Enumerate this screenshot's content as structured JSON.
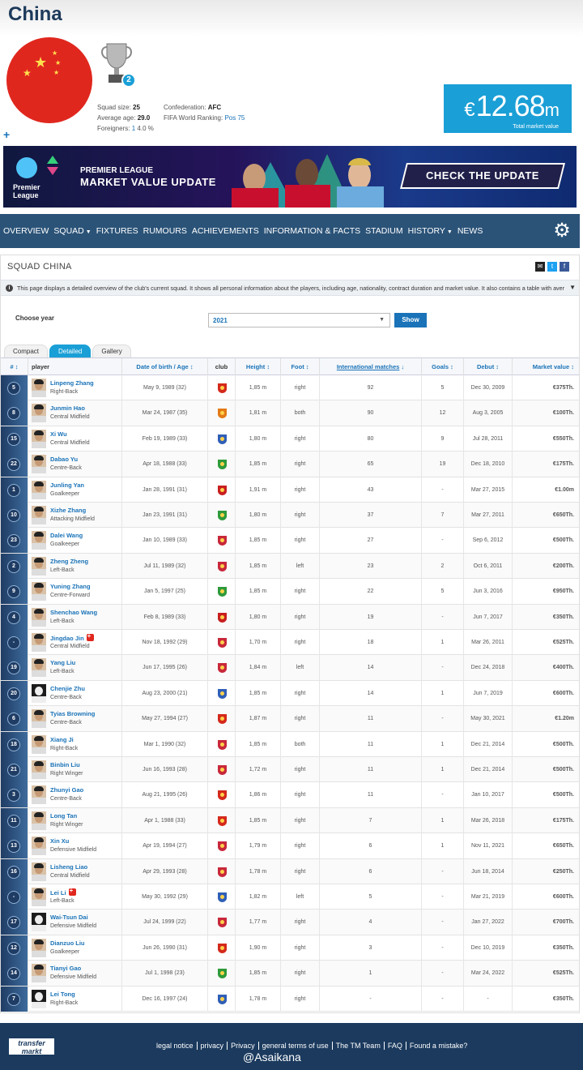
{
  "club": {
    "name": "China",
    "trophy_count": "2",
    "stats": {
      "squad_size_label": "Squad size:",
      "squad_size": "25",
      "average_age_label": "Average age:",
      "average_age": "29.0",
      "foreigners_label": "Foreigners:",
      "foreigners": "1",
      "foreigners_pct": "4.0 %",
      "confederation_label": "Confederation:",
      "confederation": "AFC",
      "ranking_label": "FIFA World Ranking:",
      "ranking": "Pos 75"
    },
    "market_value": {
      "currency": "€",
      "amount": "12.68",
      "unit": "m",
      "label": "Total market value"
    },
    "plus": "+"
  },
  "banner": {
    "logo_text": "Premier League",
    "line1": "PREMIER LEAGUE",
    "line2": "MARKET VALUE UPDATE",
    "cta": "CHECK THE UPDATE"
  },
  "nav": {
    "items": [
      {
        "label": "OVERVIEW",
        "dropdown": false
      },
      {
        "label": "SQUAD",
        "dropdown": true
      },
      {
        "label": "FIXTURES",
        "dropdown": false
      },
      {
        "label": "RUMOURS",
        "dropdown": false
      },
      {
        "label": "ACHIEVEMENTS",
        "dropdown": false
      },
      {
        "label": "INFORMATION & FACTS",
        "dropdown": false
      },
      {
        "label": "STADIUM",
        "dropdown": false
      },
      {
        "label": "HISTORY",
        "dropdown": true
      },
      {
        "label": "NEWS",
        "dropdown": false
      }
    ],
    "settings_icon": "gear-icon"
  },
  "squad": {
    "title": "SQUAD CHINA",
    "info_text": "This page displays a detailed overview of the club's current squad. It shows all personal information about the players, including age, nationality, contract duration and market value. It also contains a table with average age...",
    "choose_year_label": "Choose year",
    "year_value": "2021",
    "show_button": "Show",
    "tabs": [
      "Compact",
      "Detailed",
      "Gallery"
    ],
    "active_tab": "Detailed",
    "columns": {
      "num": "#",
      "player": "player",
      "dob": "Date of birth / Age",
      "club": "club",
      "height": "Height",
      "foot": "Foot",
      "intl": "International matches",
      "goals": "Goals",
      "debut": "Debut",
      "mv": "Market value"
    },
    "players": [
      {
        "num": "5",
        "name": "Linpeng Zhang",
        "pos": "Right-Back",
        "dob": "May 9, 1989 (32)",
        "height": "1,85 m",
        "foot": "right",
        "caps": "92",
        "goals": "5",
        "debut": "Dec 30, 2009",
        "mv": "€375Th.",
        "club_color": "#d4291b",
        "inj": false,
        "dark": false
      },
      {
        "num": "8",
        "name": "Junmin Hao",
        "pos": "Central Midfield",
        "dob": "Mar 24, 1987 (35)",
        "height": "1,81 m",
        "foot": "both",
        "caps": "90",
        "goals": "12",
        "debut": "Aug 3, 2005",
        "mv": "€100Th.",
        "club_color": "#e37a16",
        "inj": false,
        "dark": false
      },
      {
        "num": "15",
        "name": "Xi Wu",
        "pos": "Central Midfield",
        "dob": "Feb 19, 1989 (33)",
        "height": "1,80 m",
        "foot": "right",
        "caps": "80",
        "goals": "9",
        "debut": "Jul 28, 2011",
        "mv": "€550Th.",
        "club_color": "#2f5fb7",
        "inj": false,
        "dark": false
      },
      {
        "num": "22",
        "name": "Dabao Yu",
        "pos": "Centre-Back",
        "dob": "Apr 18, 1988 (33)",
        "height": "1,85 m",
        "foot": "right",
        "caps": "65",
        "goals": "19",
        "debut": "Dec 18, 2010",
        "mv": "€175Th.",
        "club_color": "#2e9a3a",
        "inj": false,
        "dark": false
      },
      {
        "num": "1",
        "name": "Junling Yan",
        "pos": "Goalkeeper",
        "dob": "Jan 28, 1991 (31)",
        "height": "1,91 m",
        "foot": "right",
        "caps": "43",
        "goals": "-",
        "debut": "Mar 27, 2015",
        "mv": "€1.00m",
        "club_color": "#c81f1f",
        "inj": false,
        "dark": false
      },
      {
        "num": "10",
        "name": "Xizhe Zhang",
        "pos": "Attacking Midfield",
        "dob": "Jan 23, 1991 (31)",
        "height": "1,80 m",
        "foot": "right",
        "caps": "37",
        "goals": "7",
        "debut": "Mar 27, 2011",
        "mv": "€650Th.",
        "club_color": "#2e9a3a",
        "inj": false,
        "dark": false
      },
      {
        "num": "23",
        "name": "Dalei Wang",
        "pos": "Goalkeeper",
        "dob": "Jan 10, 1989 (33)",
        "height": "1,85 m",
        "foot": "right",
        "caps": "27",
        "goals": "-",
        "debut": "Sep 6, 2012",
        "mv": "€500Th.",
        "club_color": "#c8283a",
        "inj": false,
        "dark": false
      },
      {
        "num": "2",
        "name": "Zheng Zheng",
        "pos": "Left-Back",
        "dob": "Jul 11, 1989 (32)",
        "height": "1,85 m",
        "foot": "left",
        "caps": "23",
        "goals": "2",
        "debut": "Oct 6, 2011",
        "mv": "€200Th.",
        "club_color": "#c8283a",
        "inj": false,
        "dark": false
      },
      {
        "num": "9",
        "name": "Yuning Zhang",
        "pos": "Centre-Forward",
        "dob": "Jan 5, 1997 (25)",
        "height": "1,85 m",
        "foot": "right",
        "caps": "22",
        "goals": "5",
        "debut": "Jun 3, 2016",
        "mv": "€950Th.",
        "club_color": "#2e9a3a",
        "inj": false,
        "dark": false
      },
      {
        "num": "4",
        "name": "Shenchao Wang",
        "pos": "Left-Back",
        "dob": "Feb 8, 1989 (33)",
        "height": "1,80 m",
        "foot": "right",
        "caps": "19",
        "goals": "-",
        "debut": "Jun 7, 2017",
        "mv": "€350Th.",
        "club_color": "#c81f1f",
        "inj": false,
        "dark": false
      },
      {
        "num": "-",
        "name": "Jingdao Jin",
        "pos": "Central Midfield",
        "dob": "Nov 18, 1992 (29)",
        "height": "1,70 m",
        "foot": "right",
        "caps": "18",
        "goals": "1",
        "debut": "Mar 26, 2011",
        "mv": "€525Th.",
        "club_color": "#c8283a",
        "inj": true,
        "dark": false
      },
      {
        "num": "19",
        "name": "Yang Liu",
        "pos": "Left-Back",
        "dob": "Jun 17, 1995 (26)",
        "height": "1,84 m",
        "foot": "left",
        "caps": "14",
        "goals": "-",
        "debut": "Dec 24, 2018",
        "mv": "€400Th.",
        "club_color": "#c8283a",
        "inj": false,
        "dark": false
      },
      {
        "num": "20",
        "name": "Chenjie Zhu",
        "pos": "Centre-Back",
        "dob": "Aug 23, 2000 (21)",
        "height": "1,85 m",
        "foot": "right",
        "caps": "14",
        "goals": "1",
        "debut": "Jun 7, 2019",
        "mv": "€600Th.",
        "club_color": "#2f5fb7",
        "inj": false,
        "dark": true
      },
      {
        "num": "6",
        "name": "Tyias Browning",
        "pos": "Centre-Back",
        "dob": "May 27, 1994 (27)",
        "height": "1,87 m",
        "foot": "right",
        "caps": "11",
        "goals": "-",
        "debut": "May 30, 2021",
        "mv": "€1.20m",
        "club_color": "#d4291b",
        "inj": false,
        "dark": false
      },
      {
        "num": "18",
        "name": "Xiang Ji",
        "pos": "Right-Back",
        "dob": "Mar 1, 1990 (32)",
        "height": "1,85 m",
        "foot": "both",
        "caps": "11",
        "goals": "1",
        "debut": "Dec 21, 2014",
        "mv": "€500Th.",
        "club_color": "#c8283a",
        "inj": false,
        "dark": false
      },
      {
        "num": "21",
        "name": "Binbin Liu",
        "pos": "Right Winger",
        "dob": "Jun 16, 1993 (28)",
        "height": "1,72 m",
        "foot": "right",
        "caps": "11",
        "goals": "1",
        "debut": "Dec 21, 2014",
        "mv": "€500Th.",
        "club_color": "#c8283a",
        "inj": false,
        "dark": false
      },
      {
        "num": "3",
        "name": "Zhunyi Gao",
        "pos": "Centre-Back",
        "dob": "Aug 21, 1995 (26)",
        "height": "1,86 m",
        "foot": "right",
        "caps": "11",
        "goals": "-",
        "debut": "Jan 10, 2017",
        "mv": "€500Th.",
        "club_color": "#d4291b",
        "inj": false,
        "dark": false
      },
      {
        "num": "11",
        "name": "Long Tan",
        "pos": "Right Winger",
        "dob": "Apr 1, 1988 (33)",
        "height": "1,85 m",
        "foot": "right",
        "caps": "7",
        "goals": "1",
        "debut": "Mar 26, 2018",
        "mv": "€175Th.",
        "club_color": "#d4291b",
        "inj": false,
        "dark": false
      },
      {
        "num": "13",
        "name": "Xin Xu",
        "pos": "Defensive Midfield",
        "dob": "Apr 19, 1994 (27)",
        "height": "1,79 m",
        "foot": "right",
        "caps": "6",
        "goals": "1",
        "debut": "Nov 11, 2021",
        "mv": "€650Th.",
        "club_color": "#c8283a",
        "inj": false,
        "dark": false
      },
      {
        "num": "16",
        "name": "Lisheng Liao",
        "pos": "Central Midfield",
        "dob": "Apr 29, 1993 (28)",
        "height": "1,78 m",
        "foot": "right",
        "caps": "6",
        "goals": "-",
        "debut": "Jun 18, 2014",
        "mv": "€250Th.",
        "club_color": "#c8283a",
        "inj": false,
        "dark": false
      },
      {
        "num": "-",
        "name": "Lei Li",
        "pos": "Left-Back",
        "dob": "May 30, 1992 (29)",
        "height": "1,82 m",
        "foot": "left",
        "caps": "5",
        "goals": "-",
        "debut": "Mar 21, 2019",
        "mv": "€600Th.",
        "club_color": "#2f5fb7",
        "inj": true,
        "dark": false
      },
      {
        "num": "17",
        "name": "Wai-Tsun Dai",
        "pos": "Defensive Midfield",
        "dob": "Jul 24, 1999 (22)",
        "height": "1,77 m",
        "foot": "right",
        "caps": "4",
        "goals": "-",
        "debut": "Jan 27, 2022",
        "mv": "€700Th.",
        "club_color": "#c8283a",
        "inj": false,
        "dark": true
      },
      {
        "num": "12",
        "name": "Dianzuo Liu",
        "pos": "Goalkeeper",
        "dob": "Jun 26, 1990 (31)",
        "height": "1,90 m",
        "foot": "right",
        "caps": "3",
        "goals": "-",
        "debut": "Dec 10, 2019",
        "mv": "€350Th.",
        "club_color": "#d4291b",
        "inj": false,
        "dark": false
      },
      {
        "num": "14",
        "name": "Tianyi Gao",
        "pos": "Defensive Midfield",
        "dob": "Jul 1, 1998 (23)",
        "height": "1,85 m",
        "foot": "right",
        "caps": "1",
        "goals": "-",
        "debut": "Mar 24, 2022",
        "mv": "€525Th.",
        "club_color": "#2e9a3a",
        "inj": false,
        "dark": false
      },
      {
        "num": "7",
        "name": "Lei Tong",
        "pos": "Right-Back",
        "dob": "Dec 16, 1997 (24)",
        "height": "1,78 m",
        "foot": "right",
        "caps": "-",
        "goals": "-",
        "debut": "-",
        "mv": "€350Th.",
        "club_color": "#2f5fb7",
        "inj": false,
        "dark": true
      }
    ]
  },
  "footer": {
    "logo_line1": "transfer",
    "logo_line2": "markt",
    "links": [
      "legal notice",
      "privacy",
      "Privacy",
      "general terms of use",
      "The TM Team",
      "FAQ",
      "Found a mistake?"
    ],
    "watermark": "@Asaikana"
  },
  "colors": {
    "nav_bg": "#2b5378",
    "accent": "#1a9fd6",
    "link": "#1a73b8",
    "flag_red": "#e0271e",
    "flag_star": "#ffe14d",
    "footer_bg": "#1b3a5e"
  }
}
